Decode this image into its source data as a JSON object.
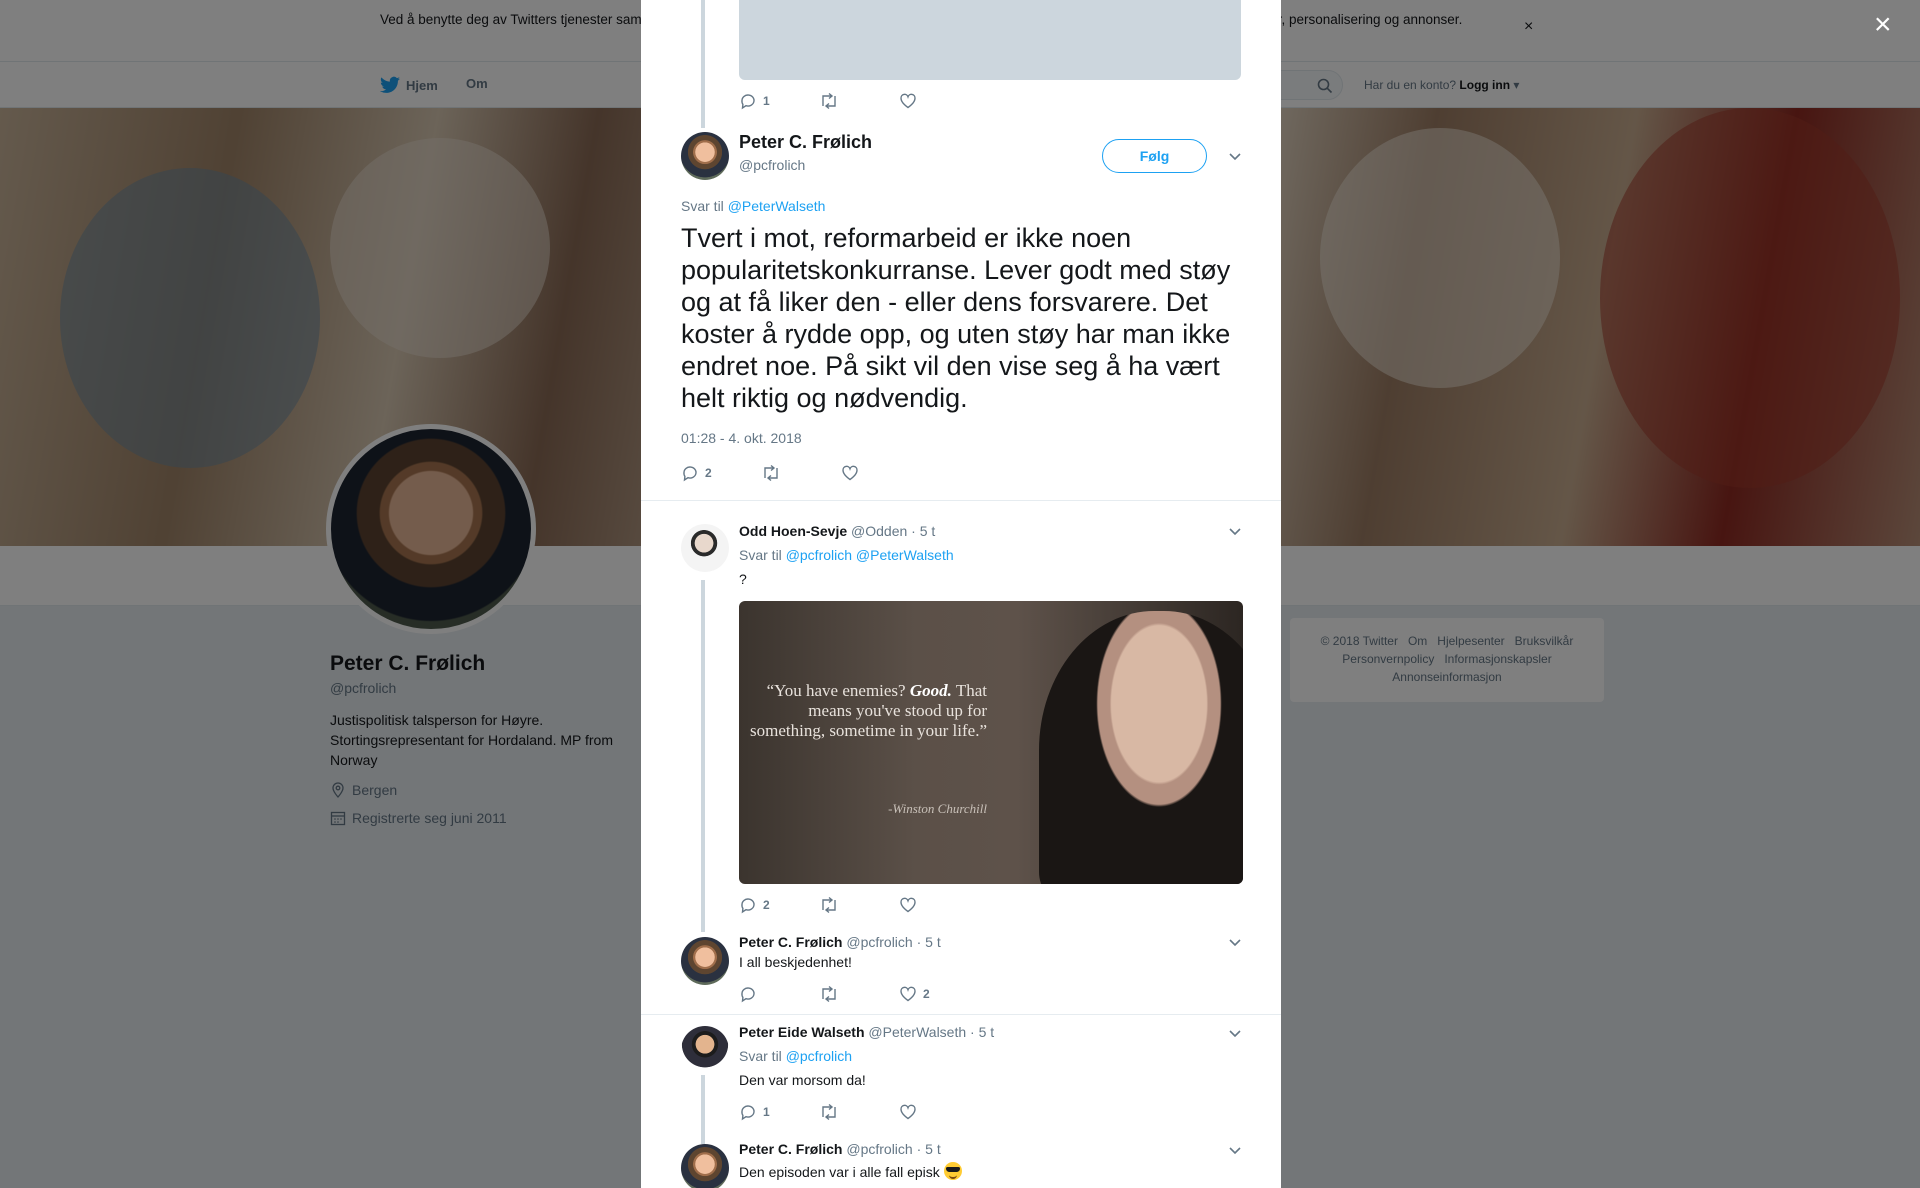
{
  "cookie": {
    "text": "Ved å benytte deg av Twitters tjenester samtykker du i vår bruk av informasjonskapsler. Vi og våre partnere bruker informasjonskapsler til bl.a. analyser, personalisering og annonser.",
    "close": "×"
  },
  "nav": {
    "home": "Hjem",
    "about": "Om",
    "login_prompt": "Har du en konto?",
    "login": "Logg inn"
  },
  "profile": {
    "name": "Peter C. Frølich",
    "handle": "@pcfrolich",
    "bio": "Justispolitisk talsperson for Høyre. Stortingsrepresentant for Hordaland. MP from Norway",
    "location": "Bergen",
    "joined": "Registrerte seg juni 2011"
  },
  "footer": {
    "links": [
      "© 2018 Twitter",
      "Om",
      "Hjelpesenter",
      "Bruksvilkår",
      "Personvernpolicy",
      "Informasjonskapsler",
      "Annonseinformasjon"
    ]
  },
  "modal": {
    "close": "×",
    "prev_actions": {
      "replies": "1",
      "retweets": "",
      "likes": ""
    },
    "main": {
      "name": "Peter C. Frølich",
      "handle": "@pcfrolich",
      "follow": "Følg",
      "reply_prefix": "Svar til",
      "reply_to": "@PeterWalseth",
      "text": "Tvert i mot, reformarbeid er ikke noen popularitetskonkurranse. Lever godt med støy og at få liker den - eller dens forsvarere. Det koster å rydde opp, og uten støy har man ikke endret noe. På sikt vil den vise seg å ha vært helt riktig og nødvendig.",
      "time": "01:28 - 4. okt. 2018",
      "replies": "2",
      "retweets": "",
      "likes": ""
    },
    "replies": [
      {
        "name": "Odd Hoen-Sevje",
        "handle": "@Odden",
        "time": "· 5 t",
        "reply_prefix": "Svar til",
        "reply_to": [
          "@pcfrolich",
          "@PeterWalseth"
        ],
        "text": "?",
        "image": {
          "quote_lead": "“You have enemies?",
          "quote_good": "Good.",
          "quote_rest": "That means you've stood up for something, sometime in your life.”",
          "attribution": "-Winston Churchill"
        },
        "replies": "2",
        "retweets": "",
        "likes": ""
      },
      {
        "name": "Peter C. Frølich",
        "handle": "@pcfrolich",
        "time": "· 5 t",
        "text": "I all beskjedenhet!",
        "replies": "",
        "retweets": "",
        "likes": "2"
      },
      {
        "name": "Peter Eide Walseth",
        "handle": "@PeterWalseth",
        "time": "· 5 t",
        "reply_prefix": "Svar til",
        "reply_to": [
          "@pcfrolich"
        ],
        "text": "Den var morsom da!",
        "replies": "1",
        "retweets": "",
        "likes": ""
      },
      {
        "name": "Peter C. Frølich",
        "handle": "@pcfrolich",
        "time": "· 5 t",
        "text": "Den episoden var i alle fall episk",
        "emoji": "smiling-face-with-sunglasses"
      }
    ]
  }
}
